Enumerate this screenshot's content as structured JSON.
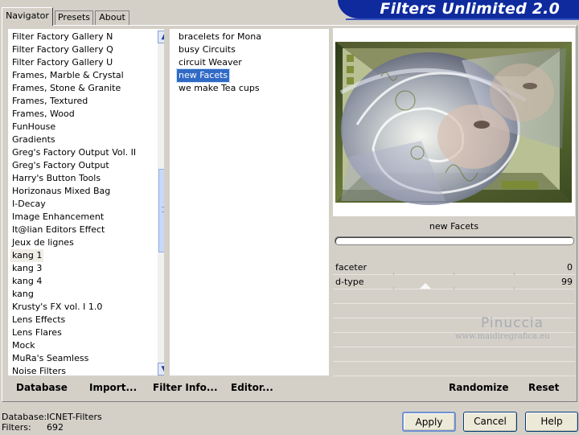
{
  "tabs": [
    {
      "label": "Navigator",
      "active": true
    },
    {
      "label": "Presets",
      "active": false
    },
    {
      "label": "About",
      "active": false
    }
  ],
  "banner": {
    "title": "Filters Unlimited 2.0"
  },
  "categories": [
    "Filter Factory Gallery N",
    "Filter Factory Gallery Q",
    "Filter Factory Gallery U",
    "Frames, Marble & Crystal",
    "Frames, Stone & Granite",
    "Frames, Textured",
    "Frames, Wood",
    "FunHouse",
    "Gradients",
    "Greg's Factory Output Vol. II",
    "Greg's Factory Output",
    "Harry's Button Tools",
    "Horizonaus Mixed Bag",
    "I-Decay",
    "Image Enhancement",
    "It@lian Editors Effect",
    "Jeux de lignes",
    "kang 1",
    "kang 3",
    "kang 4",
    "kang",
    "Krusty's FX vol. I 1.0",
    "Lens Effects",
    "Lens Flares",
    "Mock",
    "MuRa's Seamless",
    "Noise Filters"
  ],
  "selected_category": "kang 1",
  "filters": [
    "bracelets for Mona",
    "busy Circuits",
    "circuit Weaver",
    "new Facets",
    "we make Tea cups"
  ],
  "selected_filter": "new Facets",
  "preview": {
    "filter_name": "new Facets"
  },
  "params": [
    {
      "label": "faceter",
      "value": "0"
    },
    {
      "label": "d-type",
      "value": "99"
    }
  ],
  "watermark": {
    "name": "Pinuccia",
    "site": "www.maidiregrafica.eu"
  },
  "toolbar": {
    "database": "Database",
    "import": "Import...",
    "filter_info": "Filter Info...",
    "editor": "Editor...",
    "randomize": "Randomize",
    "reset": "Reset"
  },
  "status": {
    "database_label": "Database:",
    "database_value": "ICNET-Filters",
    "filters_label": "Filters:",
    "filters_value": "692"
  },
  "buttons": {
    "apply": "Apply",
    "cancel": "Cancel",
    "help": "Help"
  },
  "colors": {
    "banner": "#0e2a9c",
    "selection": "#316ac5",
    "background": "#d4d0c8"
  }
}
